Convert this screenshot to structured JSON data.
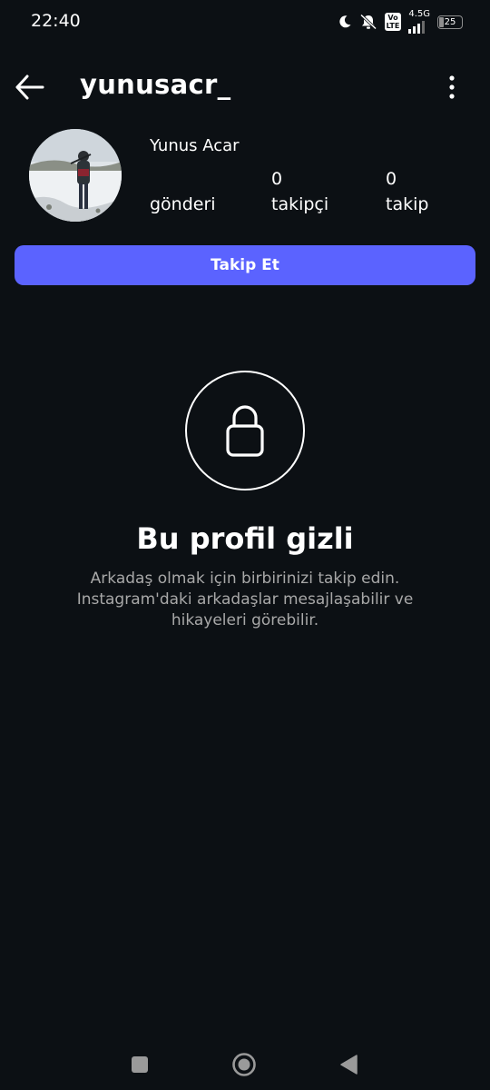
{
  "status_bar": {
    "time": "22:40",
    "volte": "Vo\nLTE",
    "network": "4.5G",
    "battery_level": "25",
    "icons": [
      "moon-icon",
      "bell-off-icon",
      "volte-icon",
      "signal-icon",
      "battery-icon"
    ]
  },
  "header": {
    "username": "yunusacr_",
    "back_icon": "arrow-left-icon",
    "more_icon": "more-vertical-icon"
  },
  "profile": {
    "full_name": "Yunus Acar",
    "stats": [
      {
        "value": "",
        "label": "gönderi"
      },
      {
        "value": "0",
        "label": "takipçi"
      },
      {
        "value": "0",
        "label": "takip"
      }
    ]
  },
  "actions": {
    "follow_label": "Takip Et"
  },
  "private_notice": {
    "icon": "lock-icon",
    "title": "Bu profil gizli",
    "description": "Arkadaş olmak için birbirinizi takip edin. Instagram'daki arkadaşlar mesajlaşabilir ve hikayeleri görebilir."
  },
  "nav_bar": {
    "icons": [
      "recents-square-icon",
      "home-circle-icon",
      "back-triangle-icon"
    ]
  },
  "colors": {
    "background": "#0c1014",
    "accent": "#5b63ff",
    "secondary_text": "#a8a8a8"
  }
}
